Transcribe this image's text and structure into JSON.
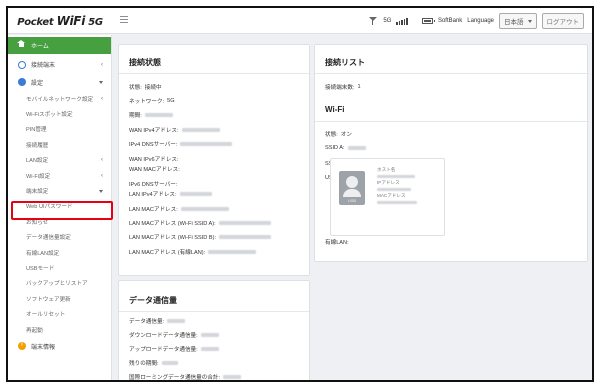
{
  "topbar": {
    "logo_prefix": "Pocket",
    "logo_main": "WiFi",
    "logo_suffix": "5G",
    "signal_type": "5G",
    "wifi_badge": "",
    "carrier": "SoftBank",
    "language_label": "Language",
    "language_value": "日本語",
    "logout_label": "ログアウト"
  },
  "sidebar": {
    "home": "ホーム",
    "devices": "接続端末",
    "settings": "設定",
    "sub_items": [
      "モバイルネットワーク設定",
      "Wi-Fiスポット設定",
      "PIN管理",
      "接続履歴",
      "LAN設定",
      "Wi-Fi設定",
      "端末設定",
      "Web UIパスワード",
      "お知らせ",
      "データ通信量設定",
      "有線LAN設定",
      "USBモード",
      "バックアップとリストア",
      "ソフトウェア更新",
      "オールリセット",
      "再起動"
    ],
    "device_info": "端末情報"
  },
  "connection_status": {
    "title": "接続状態",
    "status_label": "状態:",
    "status_value": "接続中",
    "network_label": "ネットワーク:",
    "network_value": "5G",
    "connection_label": "期間:",
    "wan_ipv4": "WAN IPv4アドレス:",
    "ipv4_dns": "IPv4 DNSサーバー:",
    "wan_ipv6": "WAN IPv6アドレス:",
    "wan_mac": "WAN MACアドレス:",
    "ipv6_dns": "IPv6 DNSサーバー:",
    "lan_ipv4": "LAN IPv4アドレス:",
    "lan_mac": "LAN MACアドレス:",
    "lan_mac_wifi_a": "LAN MACアドレス (Wi-Fi SSID A):",
    "lan_mac_wifi_b": "LAN MACアドレス (Wi-Fi SSID B):",
    "lan_mac_wired": "LAN MACアドレス (有線LAN):"
  },
  "connection_list": {
    "title": "接続リスト",
    "count_label": "接続端末数:",
    "count_value": "1",
    "wifi_title": "Wi-Fi",
    "wifi_status_label": "状態:",
    "wifi_status_value": "オン",
    "ssid_a_label": "SSID A:",
    "ssid_b_label": "SSID B:",
    "ssid_b_value": "オフ",
    "usb_label": "USB:",
    "device_icon_label": "USB",
    "host_label": "ホスト名",
    "ip_label": "IPアドレス",
    "mac_label": "MACアドレス",
    "wired_label": "有線LAN:"
  },
  "data_usage": {
    "title": "データ通信量",
    "usage_label": "データ通信量:",
    "download_label": "ダウンロードデータ通信量:",
    "upload_label": "アップロードデータ通信量:",
    "remaining_label": "残りの期間:",
    "roaming_label": "国際ローミングデータ通信量の合計:"
  },
  "colors": {
    "accent_green": "#46a040",
    "highlight_red": "#e60012",
    "icon_blue": "#3a7bd5"
  }
}
